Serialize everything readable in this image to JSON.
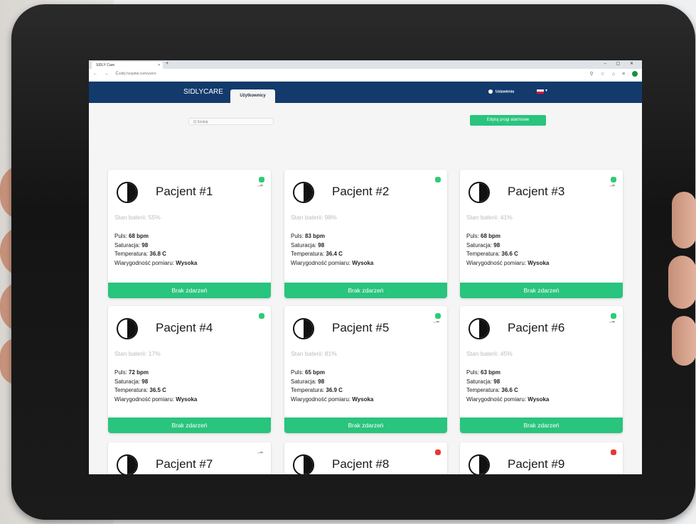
{
  "browser": {
    "tab_title": "SIDLY Care",
    "url": "sidly.hospital.com/users",
    "window_controls": "– ▢ ✕",
    "nav_buttons": "← → C",
    "ext_icons": "⚲ ☆ ⌂ ≡"
  },
  "header": {
    "logo": "SIDLYCARE",
    "tab_users": "Użytkownicy",
    "settings_label": "Ustawienia"
  },
  "toolbar": {
    "search_placeholder": "Q Szukaj",
    "alarm_button": "Edytuj progi alarmowe"
  },
  "labels": {
    "battery": "Stan baterii:",
    "pulse": "Puls:",
    "saturation": "Saturacja:",
    "temperature": "Temperatura:",
    "reliability": "Wiarygodność pomiaru:",
    "event": "Brak zdarzeń"
  },
  "colors": {
    "accent_green": "#29c47d",
    "header_navy": "#123a6b",
    "status_green": "#2ecc71",
    "status_red": "#e53935"
  },
  "patients": [
    {
      "name": "Pacjent #1",
      "battery": "55%",
      "pulse": "68 bpm",
      "saturation": "98",
      "temperature": "36.8 C",
      "reliability": "Wysoka",
      "status": "green"
    },
    {
      "name": "Pacjent #2",
      "battery": "98%",
      "pulse": "83 bpm",
      "saturation": "98",
      "temperature": "36.4 C",
      "reliability": "Wysoka",
      "status": "green"
    },
    {
      "name": "Pacjent #3",
      "battery": "41%",
      "pulse": "68 bpm",
      "saturation": "98",
      "temperature": "36.6 C",
      "reliability": "Wysoka",
      "status": "green"
    },
    {
      "name": "Pacjent #4",
      "battery": "17%",
      "pulse": "72 bpm",
      "saturation": "98",
      "temperature": "36.5 C",
      "reliability": "Wysoka",
      "status": "green"
    },
    {
      "name": "Pacjent #5",
      "battery": "81%",
      "pulse": "65 bpm",
      "saturation": "98",
      "temperature": "36.9 C",
      "reliability": "Wysoka",
      "status": "green"
    },
    {
      "name": "Pacjent #6",
      "battery": "45%",
      "pulse": "63 bpm",
      "saturation": "98",
      "temperature": "36.6 C",
      "reliability": "Wysoka",
      "status": "green"
    },
    {
      "name": "Pacjent #7",
      "status": "none"
    },
    {
      "name": "Pacjent #8",
      "status": "red"
    },
    {
      "name": "Pacjent #9",
      "status": "red"
    }
  ]
}
